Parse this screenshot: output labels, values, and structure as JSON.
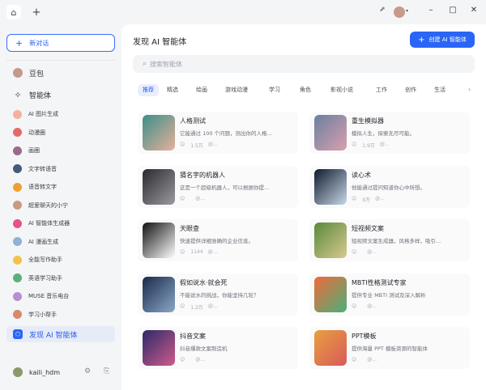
{
  "titlebar": {
    "home_icon": "⌂",
    "plus_icon": "+",
    "pin_icon": "⬈",
    "controls": [
      "–",
      "□",
      "✕"
    ]
  },
  "sidebar": {
    "new_chat": "新对话",
    "top_items": [
      {
        "label": "豆包",
        "color": "#c59a8c"
      },
      {
        "label": "智能体",
        "icon": "✧"
      }
    ],
    "agents": [
      {
        "label": "AI 图片生成",
        "color": "#f3b2a0"
      },
      {
        "label": "动漫圈",
        "color": "#e46a6a"
      },
      {
        "label": "画圈",
        "color": "#9b6a8c"
      },
      {
        "label": "文字转语音",
        "color": "#445b7a"
      },
      {
        "label": "语音转文字",
        "color": "#f0a030"
      },
      {
        "label": "超爱聊天的小宁",
        "color": "#c99a7f"
      },
      {
        "label": "AI 智能体生成器",
        "color": "#e8508a"
      },
      {
        "label": "AI 漫画生成",
        "color": "#8fb0d8"
      },
      {
        "label": "全能写作助手",
        "color": "#f2c34a"
      },
      {
        "label": "英语学习助手",
        "color": "#5bb07a"
      },
      {
        "label": "MUSE 音乐电台",
        "color": "#b58fd1"
      },
      {
        "label": "学习小帮手",
        "color": "#d88a6a"
      }
    ],
    "discover": "发现 AI 智能体",
    "user": "kaili_hdm"
  },
  "main": {
    "title": "发现 AI 智能体",
    "create_button": "创建 AI 智能体",
    "search_placeholder": "搜索智能体",
    "tabs": [
      "推荐",
      "精选",
      "绘画",
      "游戏动漫",
      "学习",
      "角色",
      "影视小说",
      "工作",
      "创作",
      "生活"
    ],
    "cards": [
      {
        "name": "人格测试",
        "desc": "它能通过 100 个问题，测出你的人格...",
        "count": "1.5万",
        "author": "@...",
        "c1": "#3a8f8a",
        "c2": "#e8b09a"
      },
      {
        "name": "重生模拟器",
        "desc": "模拟人生，探索无尽可能。",
        "count": "1.9万",
        "author": "@...",
        "c1": "#6a7fa0",
        "c2": "#d9a0b0"
      },
      {
        "name": "猜名字的机器人",
        "desc": "这是一个超级机器人，可以根据你提...",
        "count": "",
        "author": "@...",
        "c1": "#2a2a2e",
        "c2": "#9a9aa0"
      },
      {
        "name": "读心术",
        "desc": "他能通过提问知道你心中所想。",
        "count": "9万",
        "author": "@...",
        "c1": "#0e1a2e",
        "c2": "#c8d8e8"
      },
      {
        "name": "天眼查",
        "desc": "快速提供详细准确的企业信息。",
        "count": "1144",
        "author": "@...",
        "c1": "#111111",
        "c2": "#ffffff"
      },
      {
        "name": "短视频文案",
        "desc": "短视频文案生成器，风格多样，吸引...",
        "count": "",
        "author": "@...",
        "c1": "#5a8a3a",
        "c2": "#d8c890"
      },
      {
        "name": "假如说水·就会死",
        "desc": "不能说水的挑战，你能坚持几轮？",
        "count": "1.2万",
        "author": "@...",
        "c1": "#1a2a4a",
        "c2": "#8aa8c8"
      },
      {
        "name": "MBTI性格测试专家",
        "desc": "提供专业 MBTI 测试及深入解析",
        "count": "",
        "author": "@...",
        "c1": "#f06a3a",
        "c2": "#4ab07a"
      },
      {
        "name": "抖音文案",
        "desc": "抖音爆款文案制造机",
        "count": "",
        "author": "@...",
        "c1": "#2a2a6a",
        "c2": "#d05a8a"
      },
      {
        "name": "PPT模板",
        "desc": "提供海量 PPT 模板资源的智能体",
        "count": "",
        "author": "@...",
        "c1": "#e8a040",
        "c2": "#d85a5a"
      }
    ]
  }
}
